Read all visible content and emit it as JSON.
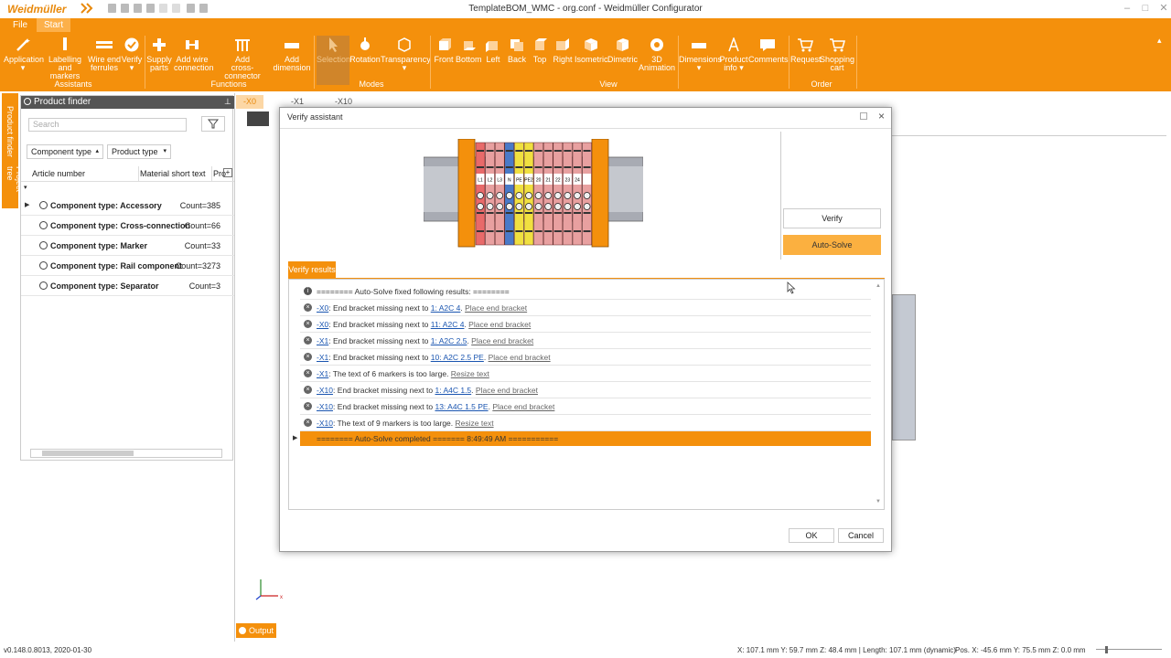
{
  "app": {
    "logo": "Weidmüller",
    "window_title": "TemplateBOM_WMC - org.conf - Weidmüller Configurator"
  },
  "ribbon": {
    "tabs": [
      "File",
      "Start"
    ],
    "buttons": [
      {
        "l1": "Application",
        "l2": "▾"
      },
      {
        "l1": "Labelling",
        "l2": "and markers"
      },
      {
        "l1": "Wire end",
        "l2": "ferrules"
      },
      {
        "l1": "Verify",
        "l2": "▾"
      },
      {
        "l1": "Supply",
        "l2": "parts"
      },
      {
        "l1": "Add wire",
        "l2": "connection"
      },
      {
        "l1": "Add",
        "l2": "cross-connector"
      },
      {
        "l1": "Add",
        "l2": "dimension"
      },
      {
        "l1": "Selection",
        "l2": ""
      },
      {
        "l1": "Rotation",
        "l2": ""
      },
      {
        "l1": "Transparency",
        "l2": "▾"
      },
      {
        "l1": "Front",
        "l2": ""
      },
      {
        "l1": "Bottom",
        "l2": ""
      },
      {
        "l1": "Left",
        "l2": ""
      },
      {
        "l1": "Back",
        "l2": ""
      },
      {
        "l1": "Top",
        "l2": ""
      },
      {
        "l1": "Right",
        "l2": ""
      },
      {
        "l1": "Isometric",
        "l2": ""
      },
      {
        "l1": "Dimetric",
        "l2": ""
      },
      {
        "l1": "3D",
        "l2": "Animation"
      },
      {
        "l1": "Dimensions",
        "l2": "▾"
      },
      {
        "l1": "Product",
        "l2": "info ▾"
      },
      {
        "l1": "Comments",
        "l2": ""
      },
      {
        "l1": "Request",
        "l2": ""
      },
      {
        "l1": "Shopping",
        "l2": "cart"
      }
    ],
    "groups": [
      "Assistants",
      "Functions",
      "Modes",
      "View",
      "Order"
    ]
  },
  "side_tabs": [
    "Product finder",
    "Project tree"
  ],
  "product_finder": {
    "title": "Product finder",
    "search_placeholder": "Search",
    "filter1": "Component type",
    "filter2": "Product type",
    "columns": [
      "Article number",
      "Material short text",
      "Pro"
    ],
    "rows": [
      {
        "name": "Component type: Accessory",
        "count": "Count=385"
      },
      {
        "name": "Component type: Cross-connection",
        "count": "Count=66"
      },
      {
        "name": "Component type: Marker",
        "count": "Count=33"
      },
      {
        "name": "Component type: Rail component",
        "count": "Count=3273"
      },
      {
        "name": "Component type: Separator",
        "count": "Count=3"
      }
    ]
  },
  "doc_tabs": [
    "-X0",
    "-X1",
    "-X10"
  ],
  "dialog": {
    "title": "Verify assistant",
    "verify_label": "Verify",
    "autosolve_label": "Auto-Solve",
    "results_tab": "Verify results",
    "header_row": "======== Auto-Solve fixed following results: ========",
    "results": [
      {
        "tag": "-X0",
        "mid": ": End bracket missing next to ",
        "ref": "1: A2C 4",
        "action": "Place end bracket"
      },
      {
        "tag": "-X0",
        "mid": ": End bracket missing next to ",
        "ref": "11: A2C 4",
        "action": "Place end bracket"
      },
      {
        "tag": "-X1",
        "mid": ": End bracket missing next to ",
        "ref": "1: A2C 2.5",
        "action": "Place end bracket"
      },
      {
        "tag": "-X1",
        "mid": ": End bracket missing next to ",
        "ref": "10: A2C 2.5 PE",
        "action": "Place end bracket"
      },
      {
        "tag": "-X1",
        "mid": ": The text of 6 markers is too large",
        "ref": "",
        "action": "Resize text"
      },
      {
        "tag": "-X10",
        "mid": ": End bracket missing next to ",
        "ref": "1: A4C 1.5",
        "action": "Place end bracket"
      },
      {
        "tag": "-X10",
        "mid": ": End bracket missing next to ",
        "ref": "13: A4C 1.5 PE",
        "action": "Place end bracket"
      },
      {
        "tag": "-X10",
        "mid": ": The text of 9 markers is too large",
        "ref": "",
        "action": "Resize text"
      }
    ],
    "done_row": "======== Auto-Solve completed ======= 8:49:49 AM ===========",
    "ok": "OK",
    "cancel": "Cancel",
    "marker_labels": [
      "L1",
      "L2",
      "L3",
      "N",
      "PE",
      "PE2",
      "20",
      "21",
      "22",
      "23",
      "24"
    ]
  },
  "output_label": "Output",
  "status": {
    "version": "v0.148.0.8013, 2020-01-30",
    "coords": "X: 107.1 mm Y: 59.7 mm Z: 48.4 mm | Length: 107.1 mm (dynamic)",
    "pos": "Pos. X: -45.6 mm Y: 75.5 mm Z: 0.0 mm"
  },
  "colors": {
    "accent": "#f4900c",
    "accent_light": "#fbb040",
    "link": "#1a55b0"
  }
}
